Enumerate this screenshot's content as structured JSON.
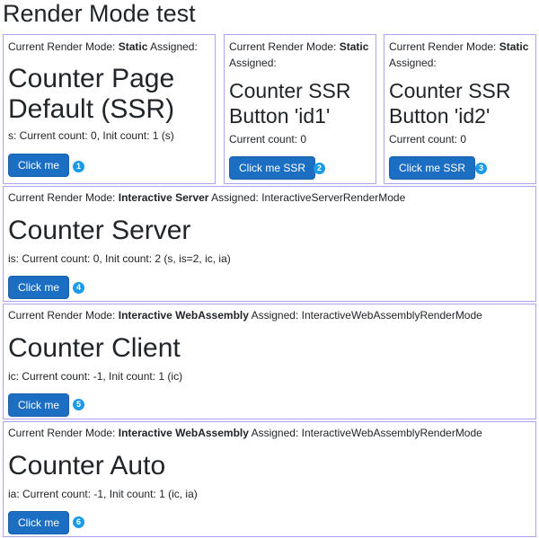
{
  "page": {
    "title": "Render Mode test"
  },
  "panels": [
    {
      "mode_prefix": "Current Render Mode:",
      "mode_value": "Static",
      "assigned_prefix": "Assigned:",
      "assigned_value": "",
      "heading_line1": "Counter Page",
      "heading_line2": "Default (SSR)",
      "count_text": "s: Current count: 0, Init count: 1 (s)",
      "button_label": "Click me",
      "badge": "1"
    },
    {
      "mode_prefix": "Current Render Mode:",
      "mode_value": "Static",
      "assigned_prefix": "Assigned:",
      "assigned_value": "",
      "heading_line1": "Counter SSR",
      "heading_line2": "Button 'id1'",
      "count_text": "Current count: 0",
      "button_label": "Click me SSR",
      "badge": "2"
    },
    {
      "mode_prefix": "Current Render Mode:",
      "mode_value": "Static",
      "assigned_prefix": "Assigned:",
      "assigned_value": "",
      "heading_line1": "Counter SSR",
      "heading_line2": "Button 'id2'",
      "count_text": "Current count: 0",
      "button_label": "Click me SSR",
      "badge": "3"
    },
    {
      "mode_prefix": "Current Render Mode:",
      "mode_value": "Interactive Server",
      "assigned_prefix": "Assigned:",
      "assigned_value": "InteractiveServerRenderMode",
      "heading": "Counter Server",
      "count_text": "is: Current count: 0, Init count: 2 (s, is=2, ic, ia)",
      "button_label": "Click me",
      "badge": "4"
    },
    {
      "mode_prefix": "Current Render Mode:",
      "mode_value": "Interactive WebAssembly",
      "assigned_prefix": "Assigned:",
      "assigned_value": "InteractiveWebAssemblyRenderMode",
      "heading": "Counter Client",
      "count_text": "ic: Current count: -1, Init count: 1 (ic)",
      "button_label": "Click me",
      "badge": "5"
    },
    {
      "mode_prefix": "Current Render Mode:",
      "mode_value": "Interactive WebAssembly",
      "assigned_prefix": "Assigned:",
      "assigned_value": "InteractiveWebAssemblyRenderMode",
      "heading": "Counter Auto",
      "count_text": "ia: Current count: -1, Init count: 1 (ic, ia)",
      "button_label": "Click me",
      "badge": "6"
    }
  ],
  "colors": {
    "button": "#1b6ec2",
    "badge": "#1a9ae8",
    "panel_border": "#a9a3f0"
  }
}
